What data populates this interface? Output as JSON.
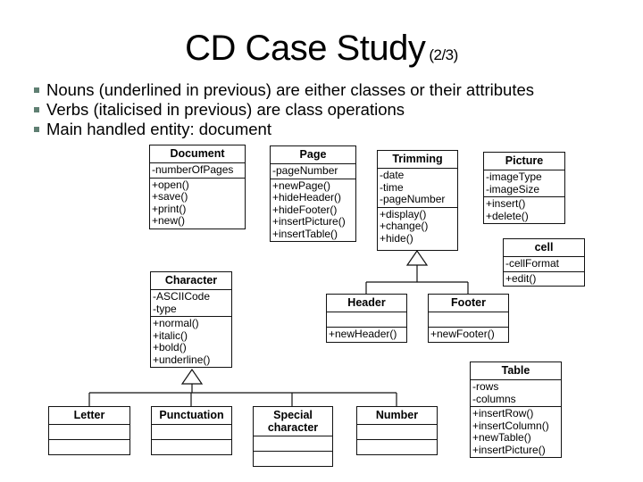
{
  "slide": {
    "title": "CD Case Study",
    "title_suffix": "(2/3)",
    "bullets": [
      "Nouns (underlined in previous) are either classes or their attributes",
      "Verbs (italicised in previous) are class operations",
      "Main handled entity: document"
    ],
    "bullet_color": "#5f7f72"
  },
  "diagram": {
    "classes": {
      "document": {
        "name": "Document",
        "attributes": [
          "-numberOfPages"
        ],
        "operations": [
          "+open()",
          "+save()",
          "+print()",
          "+new()"
        ]
      },
      "page": {
        "name": "Page",
        "attributes": [
          "-pageNumber"
        ],
        "operations": [
          "+newPage()",
          "+hideHeader()",
          "+hideFooter()",
          "+insertPicture()",
          "+insertTable()"
        ]
      },
      "trimming": {
        "name": "Trimming",
        "attributes": [
          "-date",
          "-time",
          "-pageNumber"
        ],
        "operations": [
          "+display()",
          "+change()",
          "+hide()"
        ]
      },
      "picture": {
        "name": "Picture",
        "attributes": [
          "-imageType",
          "-imageSize"
        ],
        "operations": [
          "+insert()",
          "+delete()"
        ]
      },
      "cell": {
        "name": "cell",
        "attributes": [
          "-cellFormat"
        ],
        "operations": [
          "+edit()"
        ]
      },
      "header": {
        "name": "Header",
        "attributes": [],
        "operations": [
          "+newHeader()"
        ]
      },
      "footer": {
        "name": "Footer",
        "attributes": [],
        "operations": [
          "+newFooter()"
        ]
      },
      "character": {
        "name": "Character",
        "attributes": [
          "-ASCIICode",
          "-type"
        ],
        "operations": [
          "+normal()",
          "+italic()",
          "+bold()",
          "+underline()"
        ]
      },
      "table": {
        "name": "Table",
        "attributes": [
          "-rows",
          "-columns"
        ],
        "operations": [
          "+insertRow()",
          "+insertColumn()",
          "+newTable()",
          "+insertPicture()"
        ]
      },
      "letter": {
        "name": "Letter",
        "attributes": [],
        "operations": []
      },
      "punctuation": {
        "name": "Punctuation",
        "attributes": [],
        "operations": []
      },
      "special_character": {
        "name": "Special character",
        "name_lines": [
          "Special",
          "character"
        ],
        "attributes": [],
        "operations": []
      },
      "number": {
        "name": "Number",
        "attributes": [],
        "operations": []
      }
    },
    "generalizations": [
      {
        "parent": "Trimming",
        "children": [
          "Header",
          "Footer"
        ]
      },
      {
        "parent": "Character",
        "children": [
          "Letter",
          "Punctuation",
          "Special character",
          "Number"
        ]
      }
    ]
  }
}
